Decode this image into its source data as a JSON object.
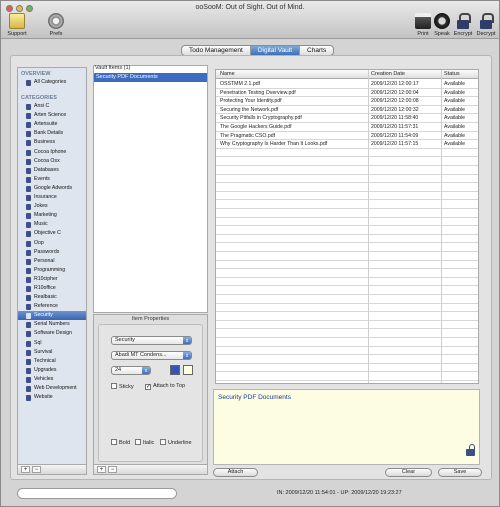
{
  "window": {
    "title": "ooSooM: Out of Sight. Out of Mind."
  },
  "toolbar": {
    "support": "Support",
    "prefs": "Prefs",
    "print": "Print",
    "speak": "Speak",
    "encrypt": "Encrypt",
    "decrypt": "Decrypt"
  },
  "tabs": [
    {
      "label": "Todo Management"
    },
    {
      "label": "Digital Vault"
    },
    {
      "label": "Charts"
    }
  ],
  "sidebar": {
    "overview_header": "OVERVIEW",
    "all_categories": "All Categories",
    "categories_header": "CATEGORIES",
    "categories": [
      "Ansi C",
      "Arten Science",
      "Artensuite",
      "Bank Details",
      "Business",
      "Cocoa Iphone",
      "Cocoa Osx",
      "Databases",
      "Events",
      "Google Adwords",
      "Insurance",
      "Jokes",
      "Marketing",
      "Music",
      "Objective C",
      "Oop",
      "Passwords",
      "Personal",
      "Programming",
      "R10cipher",
      "R10office",
      "Realbasic",
      "Reference",
      "Security",
      "Serial Numbers",
      "Software Design",
      "Sql",
      "Survival",
      "Technical",
      "Upgrades",
      "Vehicles",
      "Web Development",
      "Website"
    ],
    "selected": "Security",
    "add": "+",
    "remove": "−"
  },
  "vault": {
    "header": "Vault Items (1)",
    "items": [
      "Security PDF Documents"
    ]
  },
  "properties": {
    "title": "Item Properties",
    "category": "Security",
    "font": "Abadi MT Condens...",
    "size": "24",
    "sticky": "Sticky",
    "attach_to_top": "Attach to Top",
    "bold": "Bold",
    "italic": "Italic",
    "underline": "Underline",
    "color_primary": "#3355b8",
    "color_secondary": "#fdfde3"
  },
  "files": {
    "columns": [
      "Name",
      "Creation Date",
      "Status"
    ],
    "rows": [
      [
        "OSSTMM 2.1.pdf",
        "2009/12/20  12:00:17",
        "Available"
      ],
      [
        "Penetration Testing Overview.pdf",
        "2009/12/20  12:00:04",
        "Available"
      ],
      [
        "Protecting Your Identity.pdf",
        "2009/12/20  12:00:08",
        "Available"
      ],
      [
        "Securing the Network.pdf",
        "2009/12/20  12:00:32",
        "Available"
      ],
      [
        "Security Pitfalls in Cryptography.pdf",
        "2009/12/20  11:58:40",
        "Available"
      ],
      [
        "The Google Hackers Guide.pdf",
        "2009/12/20  11:57:31",
        "Available"
      ],
      [
        "The Pragmatic CSO.pdf",
        "2009/12/20  11:54:09",
        "Available"
      ],
      [
        "Why Cryptography Is Harder Than It Looks.pdf",
        "2009/12/20  11:57:15",
        "Available"
      ]
    ]
  },
  "notes": {
    "title": "Security PDF Documents"
  },
  "buttons": {
    "attach": "Attach",
    "clear": "Clear",
    "save": "Save"
  },
  "status_bar": {
    "text": "IN: 2009/12/20  11:54:01 - UP: 2009/12/20  19:23:27"
  }
}
